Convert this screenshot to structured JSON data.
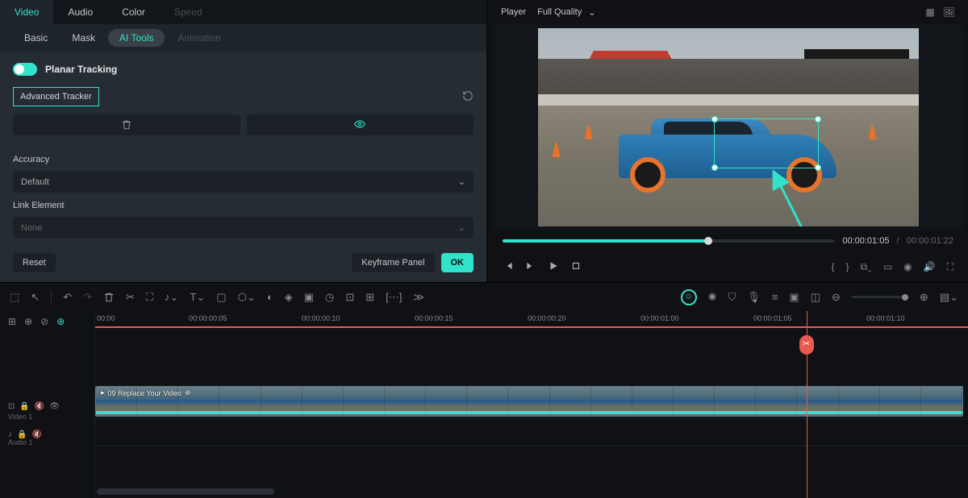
{
  "main_tabs": {
    "video": "Video",
    "audio": "Audio",
    "color": "Color",
    "speed": "Speed"
  },
  "sub_tabs": {
    "basic": "Basic",
    "mask": "Mask",
    "ai_tools": "AI Tools",
    "animation": "Animation"
  },
  "panel": {
    "planar_tracking": "Planar Tracking",
    "advanced_tracker": "Advanced Tracker",
    "accuracy_label": "Accuracy",
    "accuracy_value": "Default",
    "link_label": "Link Element",
    "link_value": "None",
    "reset": "Reset",
    "keyframe_panel": "Keyframe Panel",
    "ok": "OK"
  },
  "player": {
    "title": "Player",
    "quality": "Full Quality",
    "current_time": "00:00:01:05",
    "total_time": "00:00:01:22",
    "sep": "/"
  },
  "ruler": {
    "t0": "00:00",
    "t1": "00:00:00:05",
    "t2": "00:00:00:10",
    "t3": "00:00:00:15",
    "t4": "00:00:00:20",
    "t5": "00:00:01:00",
    "t6": "00:00:01:05",
    "t7": "00:00:01:10"
  },
  "tracks": {
    "video1": "Video 1",
    "audio1": "Audio 1",
    "clip_title": "09 Replace Your Video"
  }
}
